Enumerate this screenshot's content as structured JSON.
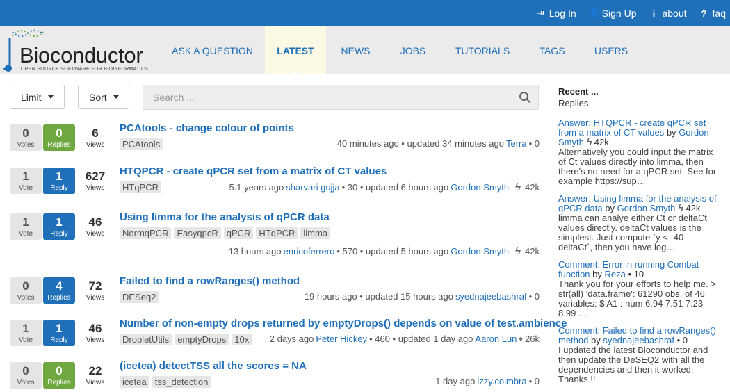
{
  "topnav": {
    "login": "Log In",
    "signup": "Sign Up",
    "about": "about",
    "faq": "faq"
  },
  "logo": {
    "name": "Bioconductor",
    "tagline": "OPEN SOURCE SOFTWARE FOR BIOINFORMATICS"
  },
  "mainnav": [
    "ASK A QUESTION",
    "LATEST",
    "NEWS",
    "JOBS",
    "TUTORIALS",
    "TAGS",
    "USERS"
  ],
  "filters": {
    "limit": "Limit",
    "sort": "Sort",
    "search_placeholder": "Search ..."
  },
  "posts": [
    {
      "votes": "0",
      "vote_label": "Votes",
      "replies": "0",
      "reply_label": "Replies",
      "reply_state": "green",
      "views": "6",
      "views_label": "Views",
      "title": "PCAtools - change colour of points",
      "tags": [
        "PCAtools"
      ],
      "meta_pre": "40 minutes ago • updated 34 minutes ago",
      "user1": "",
      "rep1": "",
      "user2": "Terra",
      "rep2": "• 0",
      "badge": ""
    },
    {
      "votes": "1",
      "vote_label": "Vote",
      "replies": "1",
      "reply_label": "Reply",
      "reply_state": "blue",
      "views": "627",
      "views_label": "Views",
      "title": "HTQPCR - create qPCR set from a matrix of CT values",
      "tags": [
        "HTqPCR"
      ],
      "meta_pre": "5.1 years ago",
      "user1": "sharvari gujja",
      "rep1": "• 30 • updated 6 hours ago",
      "user2": "Gordon Smyth",
      "rep2": "42k",
      "badge": "bolt"
    },
    {
      "votes": "1",
      "vote_label": "Vote",
      "replies": "1",
      "reply_label": "Reply",
      "reply_state": "blue",
      "views": "46",
      "views_label": "Views",
      "title": "Using limma for the analysis of qPCR data",
      "tags": [
        "NormqPCR",
        "EasyqpcR",
        "qPCR",
        "HTqPCR",
        "limma"
      ],
      "meta_pre": "13 hours ago",
      "user1": "enricoferrero",
      "rep1": "• 570 • updated 5 hours ago",
      "user2": "Gordon Smyth",
      "rep2": "42k",
      "badge": "bolt"
    },
    {
      "votes": "0",
      "vote_label": "Votes",
      "replies": "4",
      "reply_label": "Replies",
      "reply_state": "blue",
      "views": "72",
      "views_label": "Views",
      "title": "Failed to find a rowRanges() method",
      "tags": [
        "DESeq2"
      ],
      "meta_pre": "19 hours ago • updated 15 hours ago",
      "user1": "",
      "rep1": "",
      "user2": "syednajeebashraf",
      "rep2": "• 0",
      "badge": ""
    },
    {
      "votes": "1",
      "vote_label": "Vote",
      "replies": "1",
      "reply_label": "Reply",
      "reply_state": "blue",
      "views": "46",
      "views_label": "Views",
      "title": "Number of non-empty drops returned by emptyDrops() depends on value of test.ambience",
      "tags": [
        "DropletUtils",
        "emptyDrops",
        "10x"
      ],
      "meta_pre": "2 days ago",
      "user1": "Peter Hickey",
      "rep1": "• 460 • updated 1 day ago",
      "user2": "Aaron Lun",
      "rep2": "26k",
      "badge": "diamond"
    },
    {
      "votes": "0",
      "vote_label": "Votes",
      "replies": "0",
      "reply_label": "Replies",
      "reply_state": "green",
      "views": "22",
      "views_label": "Views",
      "title": "(icetea) detectTSS all the scores = NA",
      "tags": [
        "icetea",
        "tss_detection"
      ],
      "meta_pre": "1 day ago",
      "user1": "",
      "rep1": "",
      "user2": "izzy.coimbra",
      "rep2": "• 0",
      "badge": ""
    }
  ],
  "sidebar": {
    "title": "Recent ...",
    "subtitle": "Replies",
    "entries": [
      {
        "link": "Answer: HTQPCR - create qPCR set from a matrix of CT values",
        "by": "by",
        "user": "Gordon Smyth",
        "rep": "42k",
        "badge": "bolt",
        "text": "Alternatively you could input the matrix of Ct values directly into limma, then there's no need for a qPCR set. See for example https://sup…"
      },
      {
        "link": "Answer: Using limma for the analysis of qPCR data",
        "by": "by",
        "user": "Gordon Smyth",
        "rep": "42k",
        "badge": "bolt",
        "text": "limma can analye either Ct or deltaCt values directly. deltaCt values is the simplest. Just compute `y <- 40 - deltaCt`, then you have log…"
      },
      {
        "link": "Comment: Error in running Combat function",
        "by": "by",
        "user": "Reza",
        "rep": "• 10",
        "badge": "",
        "text": "Thank you for your efforts to help me. > str(all) 'data.frame': 61290 obs. of 46 variables: $ A1 : num 6.94 7.51 7.23 8.99 …"
      },
      {
        "link": "Comment: Failed to find a rowRanges() method",
        "by": "by",
        "user": "syednajeebashraf",
        "rep": "• 0",
        "badge": "",
        "text": "I updated the latest Bioconductor and then update the DeSEQ2 with all the dependencies and then it worked. Thanks !!"
      }
    ]
  }
}
